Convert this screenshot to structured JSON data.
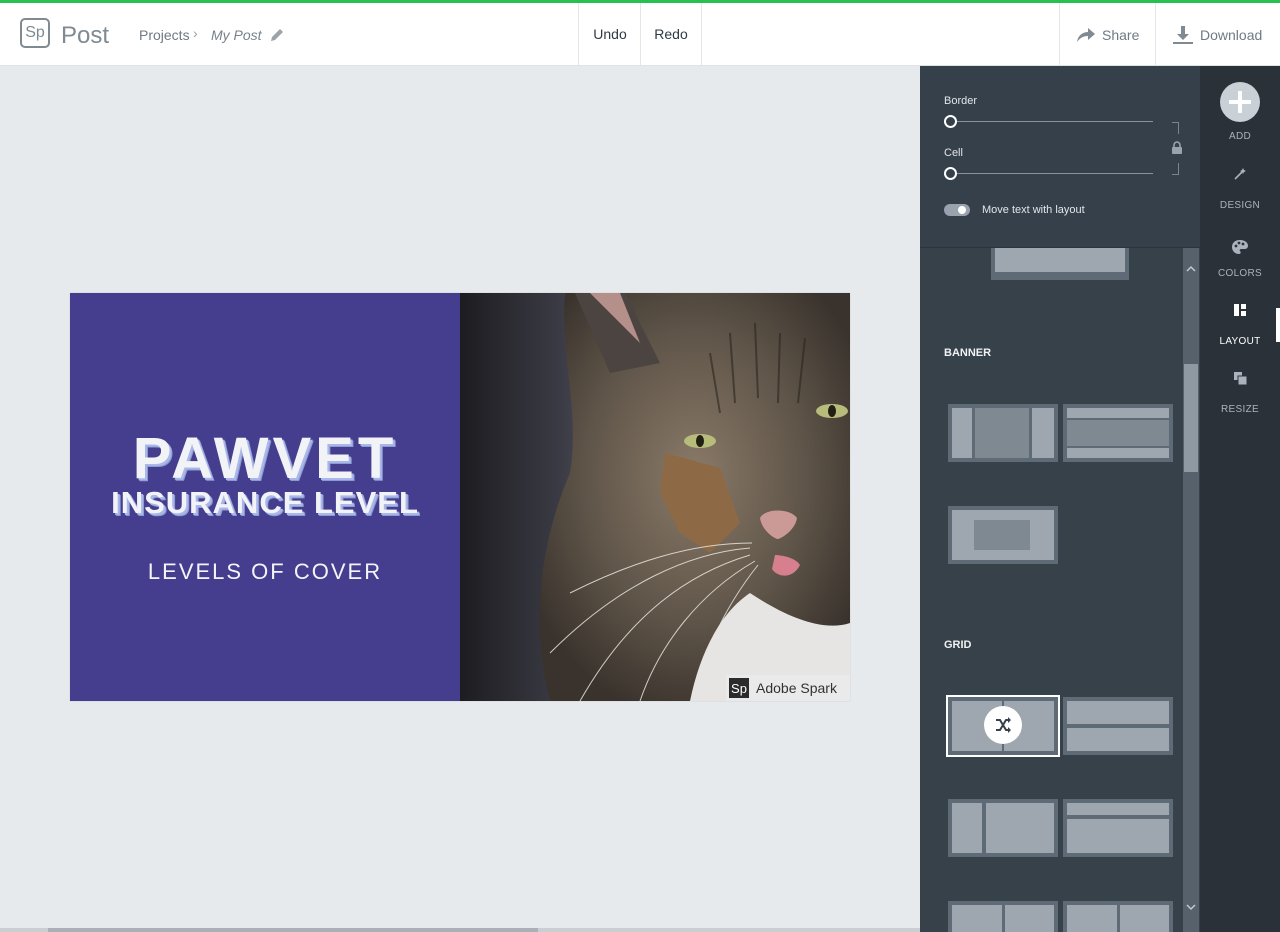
{
  "app": {
    "logo_text": "Sp",
    "name": "Post"
  },
  "breadcrumb": {
    "projects": "Projects",
    "separator": "›",
    "current": "My Post"
  },
  "toolbar": {
    "undo": "Undo",
    "redo": "Redo",
    "share": "Share",
    "download": "Download"
  },
  "post": {
    "headline_1": "PAWVET",
    "headline_2": "INSURANCE LEVEL",
    "subtitle": "LEVELS OF COVER",
    "watermark_logo": "Sp",
    "watermark_text": "Adobe Spark",
    "background_color": "#453e8f"
  },
  "controls": {
    "border_label": "Border",
    "border_value": 0,
    "cell_label": "Cell",
    "cell_value": 0,
    "move_text_label": "Move text with layout",
    "move_text_enabled": true
  },
  "layout_sections": {
    "banner": "BANNER",
    "grid": "GRID"
  },
  "nav": {
    "add": "ADD",
    "design": "DESIGN",
    "colors": "COLORS",
    "layout": "LAYOUT",
    "resize": "RESIZE",
    "active": "LAYOUT"
  },
  "colors": {
    "accent_green": "#26c14f",
    "panel": "#36414a",
    "nav": "#2a3138"
  }
}
